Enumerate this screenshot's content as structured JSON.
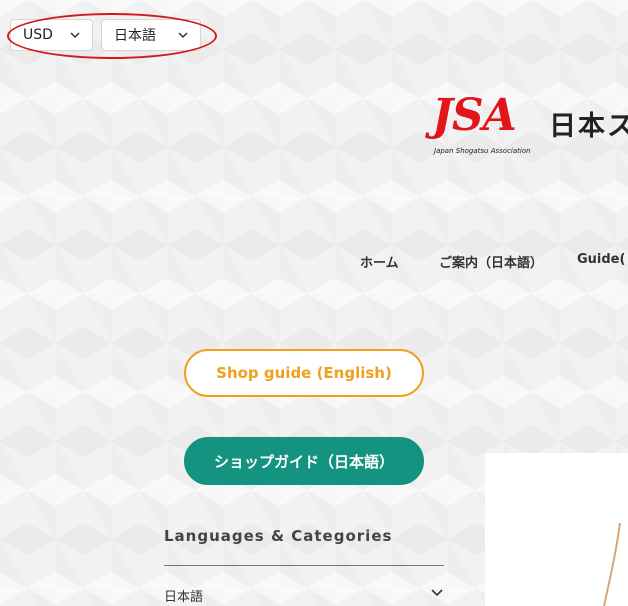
{
  "topbar": {
    "currency": "USD",
    "language": "日本語"
  },
  "logo": {
    "mark": "JSA",
    "jp_name": "日本ス",
    "en_name": "Japan Shogatsu Association"
  },
  "nav": {
    "home": "ホーム",
    "guide_jp": "ご案内（日本語）",
    "guide": "Guide("
  },
  "buttons": {
    "shop_guide_en": "Shop guide (English)",
    "shop_guide_jp": "ショップガイド（日本語）"
  },
  "languages_categories": {
    "title": "Languages & Categories",
    "items": [
      "日本語"
    ]
  },
  "colors": {
    "highlight": "#d11a1a",
    "logo_red": "#e3141a",
    "outline_orange": "#f0a020",
    "teal": "#139380"
  }
}
